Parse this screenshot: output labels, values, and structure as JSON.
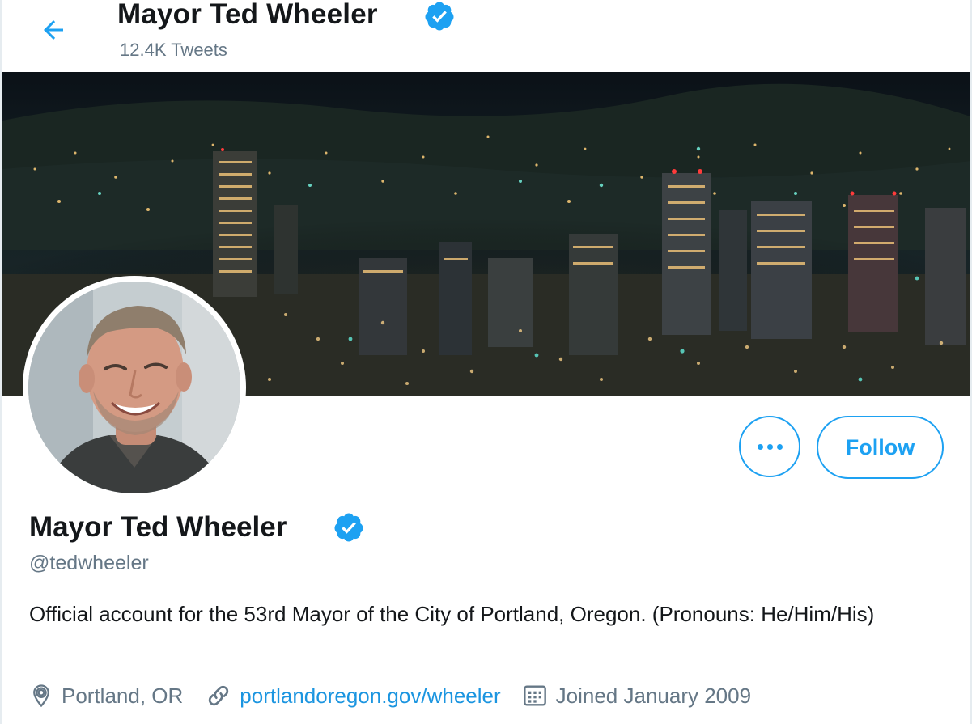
{
  "header": {
    "title": "Mayor Ted Wheeler",
    "tweet_count": "12.4K Tweets"
  },
  "profile": {
    "name": "Mayor Ted Wheeler",
    "handle": "@tedwheeler",
    "bio": "Official account for the 53rd Mayor of the City of Portland, Oregon. (Pronouns: He/Him/His)",
    "location": "Portland, OR",
    "website": "portlandoregon.gov/wheeler",
    "joined": "Joined January 2009"
  },
  "actions": {
    "follow_label": "Follow"
  },
  "icons": {
    "back": "arrow-left-icon",
    "verified": "verified-badge-icon",
    "more": "more-dots-icon",
    "location": "location-pin-icon",
    "link": "link-icon",
    "calendar": "calendar-icon"
  },
  "colors": {
    "accent": "#1da1f2",
    "text": "#14171a",
    "secondary": "#657786"
  }
}
